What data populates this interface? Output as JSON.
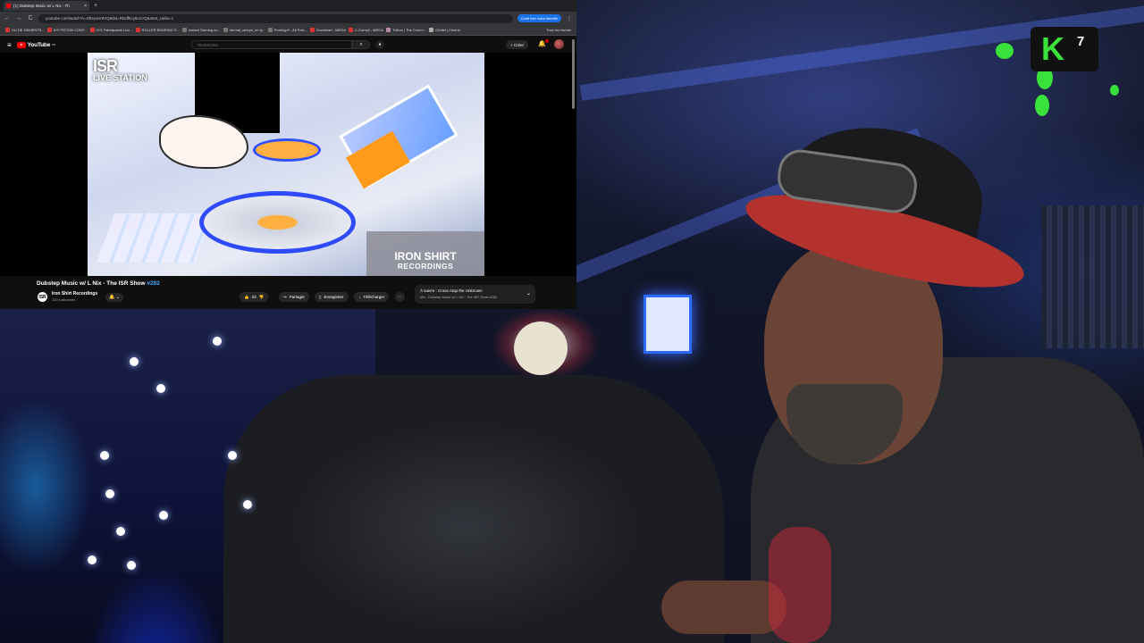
{
  "browser": {
    "tab_title": "(1) Dubstep Music w/ L Nix - Th",
    "tab_close": "×",
    "new_tab": "+",
    "url": "youtube.com/watch?v=8frey4nr9VQ&list=RDdfkcy5u1VQ&start_radio=1",
    "promo": "Confi mer votre identité",
    "nav": {
      "back": "←",
      "forward": "→",
      "reload": "C",
      "menu": "⋮"
    },
    "bookmarks": [
      "DU DE GEMENTS...",
      "DIY PISTON CONF...",
      "ICG Fabriquants Lice...",
      "ROLLER BEARING S...",
      "Instant Gaming co...",
      "ebroad_wheys_en ty...",
      "Prototyp9 - All Pols...",
      "Download - MEGA",
      "C-Compil - MEGA",
      "Tuition | The Comm...",
      "Orbitel | Celerio"
    ],
    "bookmarks_all": "Tous les favoris"
  },
  "youtube": {
    "logo_text": "YouTube",
    "logo_region": "FR",
    "search_placeholder": "Rechercher",
    "search_icon": "⌕",
    "mic_icon": "●",
    "create_label": "+ Créer",
    "video": {
      "logo_big": "ISR",
      "logo_small": "LIVE STATION",
      "watermark_line1": "IRON SHIRT",
      "watermark_line2": "RECORDINGS"
    },
    "title_main": "Dubstep Music w/ L Nix - The ISR Show ",
    "title_hash": "#282",
    "channel_initials": "ISR",
    "channel_name": "Iron Shirt Recordings",
    "subscribers": "120 k abonnés",
    "bell_label": "🔔 ⌄",
    "like_count": "23",
    "share_label": "Partager",
    "save_label": "Enregistrer",
    "download_label": "Télécharger",
    "more_label": "···",
    "next_up_label": "À suivre : Cross Atop the Unknown",
    "next_up_sub": "Mix - Dubstep Music w/ L Nix - The ISR Show #282",
    "next_chevron": "⌄"
  },
  "overlay": {
    "widget_mark": "K",
    "widget_number": "7"
  }
}
